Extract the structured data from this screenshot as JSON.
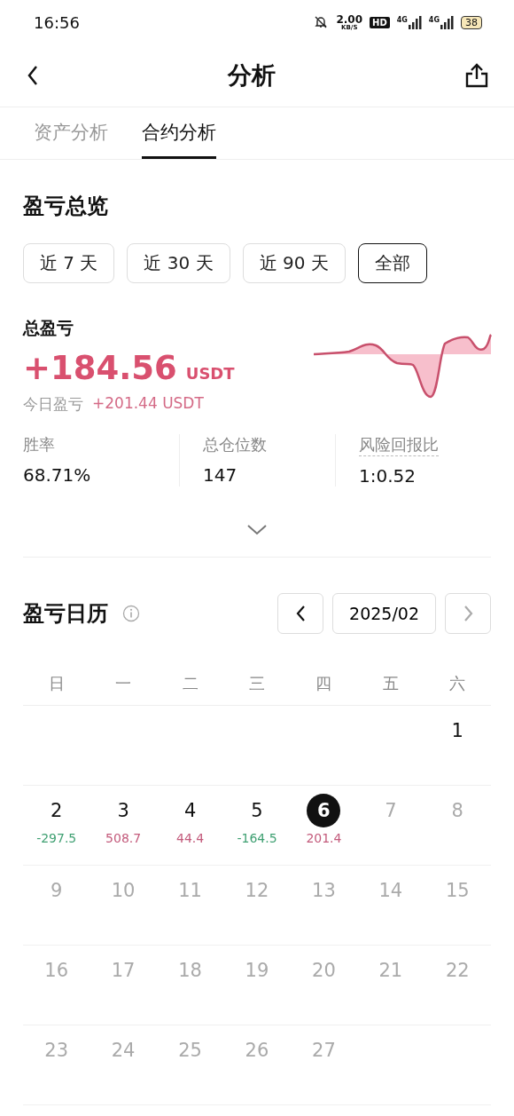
{
  "status_bar": {
    "time": "16:56",
    "net_speed": "2.00",
    "net_unit": "KB/S",
    "hd": "HD",
    "signal_1": "4G",
    "signal_2": "4G",
    "battery": "38"
  },
  "header": {
    "title": "分析"
  },
  "tabs": [
    {
      "label": "资产分析",
      "selected": false
    },
    {
      "label": "合约分析",
      "selected": true
    }
  ],
  "overview": {
    "title": "盈亏总览",
    "periods": [
      {
        "label": "近 7 天",
        "selected": false
      },
      {
        "label": "近 30 天",
        "selected": false
      },
      {
        "label": "近 90 天",
        "selected": false
      },
      {
        "label": "全部",
        "selected": true
      }
    ],
    "total_label": "总盈亏",
    "total_value": "+184.56",
    "total_unit": "USDT",
    "today_label": "今日盈亏",
    "today_value": "+201.44 USDT",
    "stats": [
      {
        "label": "胜率",
        "value": "68.71%",
        "has_tooltip": false
      },
      {
        "label": "总仓位数",
        "value": "147",
        "has_tooltip": false
      },
      {
        "label": "风险回报比",
        "value": "1:0.52",
        "has_tooltip": true
      }
    ]
  },
  "calendar": {
    "title": "盈亏日历",
    "month": "2025/02",
    "weekdays": [
      "日",
      "一",
      "二",
      "三",
      "四",
      "五",
      "六"
    ],
    "weeks": [
      {
        "days": [
          {
            "day": "1",
            "future": false,
            "selected": false
          }
        ]
      },
      {
        "days": [
          {
            "day": "2",
            "pnl": "-297.5",
            "color": "#3fa072",
            "future": false,
            "selected": false
          },
          {
            "day": "3",
            "pnl": "508.7",
            "color": "#c35a7b",
            "future": false,
            "selected": false
          },
          {
            "day": "4",
            "pnl": "44.4",
            "color": "#c35a7b",
            "future": false,
            "selected": false
          },
          {
            "day": "5",
            "pnl": "-164.5",
            "color": "#3fa072",
            "future": false,
            "selected": false
          },
          {
            "day": "6",
            "pnl": "201.4",
            "color": "#c35a7b",
            "future": false,
            "selected": true
          },
          {
            "day": "7",
            "future": true,
            "selected": false
          },
          {
            "day": "8",
            "future": true,
            "selected": false
          }
        ]
      },
      {
        "days": [
          {
            "day": "9",
            "future": true,
            "selected": false
          },
          {
            "day": "10",
            "future": true,
            "selected": false
          },
          {
            "day": "11",
            "future": true,
            "selected": false
          },
          {
            "day": "12",
            "future": true,
            "selected": false
          },
          {
            "day": "13",
            "future": true,
            "selected": false
          },
          {
            "day": "14",
            "future": true,
            "selected": false
          },
          {
            "day": "15",
            "future": true,
            "selected": false
          }
        ]
      },
      {
        "days": [
          {
            "day": "16",
            "future": true,
            "selected": false
          },
          {
            "day": "17",
            "future": true,
            "selected": false
          },
          {
            "day": "18",
            "future": true,
            "selected": false
          },
          {
            "day": "19",
            "future": true,
            "selected": false
          },
          {
            "day": "20",
            "future": true,
            "selected": false
          },
          {
            "day": "21",
            "future": true,
            "selected": false
          },
          {
            "day": "22",
            "future": true,
            "selected": false
          }
        ]
      },
      {
        "days": [
          {
            "day": "23",
            "future": true,
            "selected": false
          },
          {
            "day": "24",
            "future": true,
            "selected": false
          },
          {
            "day": "25",
            "future": true,
            "selected": false
          },
          {
            "day": "26",
            "future": true,
            "selected": false
          },
          {
            "day": "27",
            "future": true,
            "selected": false
          }
        ]
      }
    ]
  }
}
